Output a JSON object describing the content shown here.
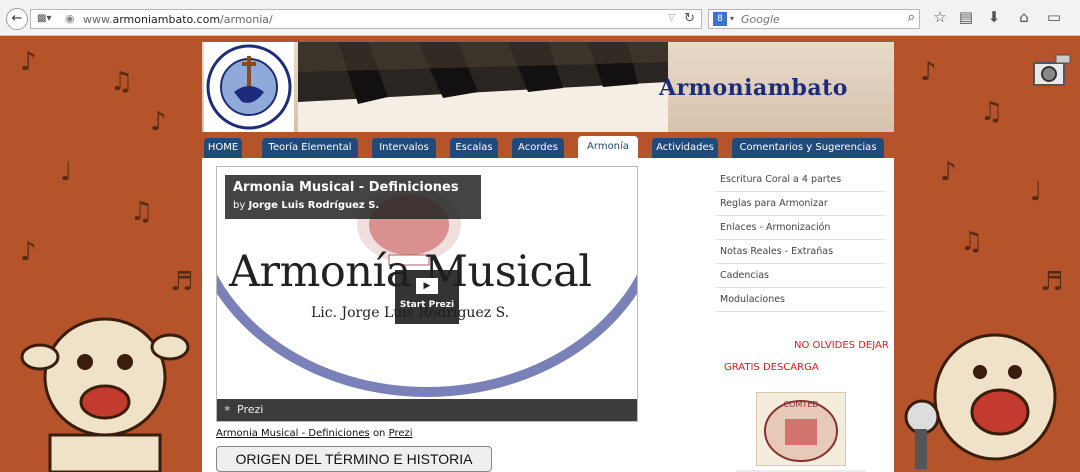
{
  "browser": {
    "url_prefix": "www.",
    "url_domain": "armoniambato.com",
    "url_path": "/armonia/",
    "search_placeholder": "Google"
  },
  "site": {
    "title": "Armoniambato"
  },
  "nav": {
    "tabs": [
      {
        "label": "HOME"
      },
      {
        "label": "Teoría Elemental"
      },
      {
        "label": "Intervalos"
      },
      {
        "label": "Escalas"
      },
      {
        "label": "Acordes"
      },
      {
        "label": "Armonía"
      },
      {
        "label": "Actividades"
      },
      {
        "label": "Comentarios y Sugerencias"
      }
    ],
    "active": "Armonía"
  },
  "prezi": {
    "title": "Armonia Musical - Definiciones",
    "author_prefix": "by",
    "author": "Jorge Luis Rodríguez S.",
    "slide_title": "Armonía Musical",
    "slide_subtitle": "Lic. Jorge Luis Rodríguez S.",
    "start_label": "Start Prezi",
    "brand_label": "Prezi"
  },
  "caption": {
    "link": "Armonia Musical - Definiciones",
    "middle": "on",
    "site_link": "Prezi"
  },
  "main": {
    "origin_button": "ORIGEN DEL TÉRMINO E HISTORIA"
  },
  "sidebar": {
    "links": [
      {
        "label": "Escritura Coral a 4 partes"
      },
      {
        "label": "Reglas para Armonizar"
      },
      {
        "label": "Enlaces - Armonización"
      },
      {
        "label": "Notas Reales - Extrañas"
      },
      {
        "label": "Cadencias"
      },
      {
        "label": "Modulaciones"
      }
    ],
    "note_1": "NO OLVIDES DEJAR",
    "note_2": "GRATIS DESCARGA",
    "img_label": "COMTED"
  },
  "colors": {
    "background": "#b5542b",
    "nav_tab": "#1f4a7a",
    "title_blue": "#1c2c7a",
    "alert_red": "#e01a1a"
  }
}
